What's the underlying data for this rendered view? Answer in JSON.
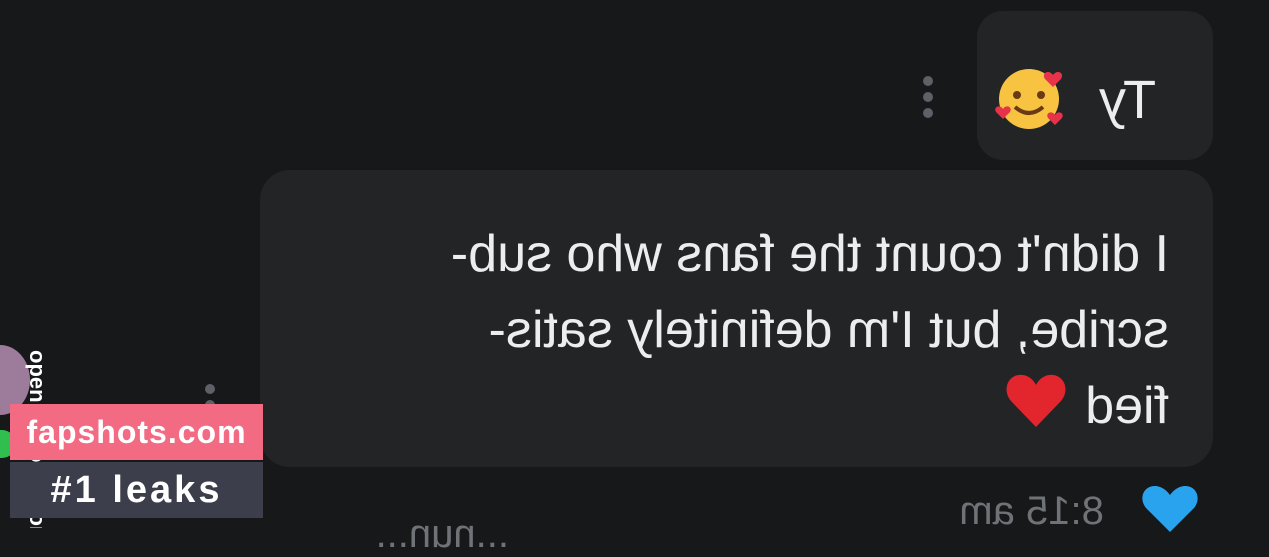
{
  "messages": [
    {
      "text": "Ty",
      "emoji": "smiling-face-with-hearts"
    },
    {
      "text": "I didn't count the fans who sub-\nscribe, but I'm definitely satis-\nfied",
      "emoji": "red-heart"
    }
  ],
  "timestamp": "8:15 am",
  "sidebar": {
    "vertical_text": "openingpools.com"
  },
  "bottom_partial": "...nun...",
  "watermark": {
    "site": "fapshots.com",
    "tagline": "#1 leaks"
  },
  "colors": {
    "background": "#17181a",
    "bubble": "#222426",
    "brand_pink": "#f26b83",
    "like_blue": "#2aa3ef"
  }
}
